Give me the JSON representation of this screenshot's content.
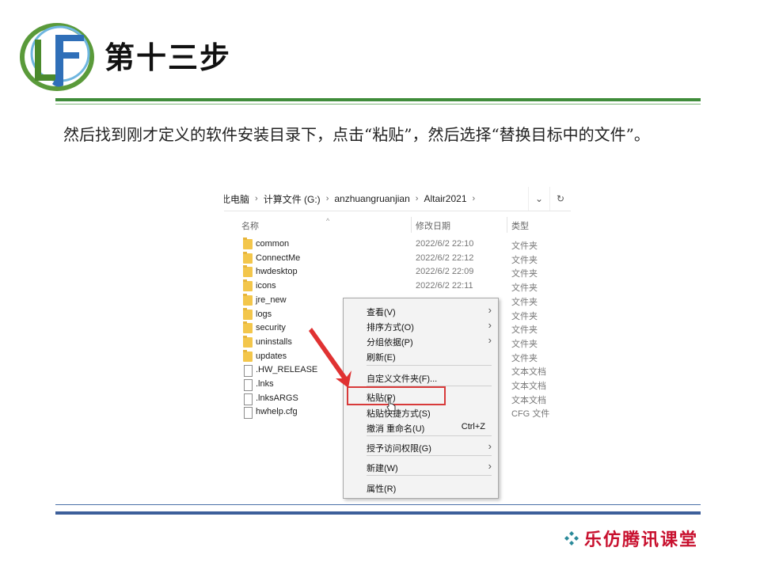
{
  "slide": {
    "title": "第十三步",
    "description": "然后找到刚才定义的软件安装目录下，点击“粘贴”，然后选择“替换目标中的文件”。",
    "brand": "乐仿腾讯课堂"
  },
  "explorer": {
    "breadcrumbs": [
      "此电脑",
      "计算文件 (G:)",
      "anzhuangruanjian",
      "Altair2021"
    ],
    "columns": {
      "name": "名称",
      "date": "修改日期",
      "type": "类型"
    },
    "rows": [
      {
        "name": "common",
        "date": "2022/6/2 22:10",
        "type": "文件夹",
        "icon": "folder-icon"
      },
      {
        "name": "ConnectMe",
        "date": "2022/6/2 22:12",
        "type": "文件夹",
        "icon": "folder-icon"
      },
      {
        "name": "hwdesktop",
        "date": "2022/6/2 22:09",
        "type": "文件夹",
        "icon": "folder-icon"
      },
      {
        "name": "icons",
        "date": "2022/6/2 22:11",
        "type": "文件夹",
        "icon": "folder-icon"
      },
      {
        "name": "jre_new",
        "date": "",
        "type": "文件夹",
        "icon": "folder-icon"
      },
      {
        "name": "logs",
        "date": "",
        "type": "文件夹",
        "icon": "folder-icon"
      },
      {
        "name": "security",
        "date": "",
        "type": "文件夹",
        "icon": "folder-icon"
      },
      {
        "name": "uninstalls",
        "date": "",
        "type": "文件夹",
        "icon": "folder-icon"
      },
      {
        "name": "updates",
        "date": "",
        "type": "文件夹",
        "icon": "folder-icon"
      },
      {
        "name": ".HW_RELEASE",
        "date": "",
        "type": "文本文档",
        "icon": "document-icon"
      },
      {
        "name": ".lnks",
        "date": "",
        "type": "文本文档",
        "icon": "document-icon"
      },
      {
        "name": ".lnksARGS",
        "date": "",
        "type": "文本文档",
        "icon": "document-icon"
      },
      {
        "name": "hwhelp.cfg",
        "date": "",
        "type": "CFG 文件",
        "icon": "document-icon"
      }
    ]
  },
  "context_menu": {
    "view": "查看(V)",
    "sort": "排序方式(O)",
    "group": "分组依据(P)",
    "refresh": "刷新(E)",
    "customize": "自定义文件夹(F)...",
    "paste": "粘贴(P)",
    "paste_shortcut": "粘贴快捷方式(S)",
    "undo": "撤消 重命名(U)",
    "undo_shortcut": "Ctrl+Z",
    "grant_access": "授予访问权限(G)",
    "new": "新建(W)",
    "properties": "属性(R)"
  },
  "colors": {
    "title_line": "#3f8c3a",
    "footer_line": "#3d5f9a",
    "highlight": "#d83a3a",
    "brand": "#c8102e"
  }
}
